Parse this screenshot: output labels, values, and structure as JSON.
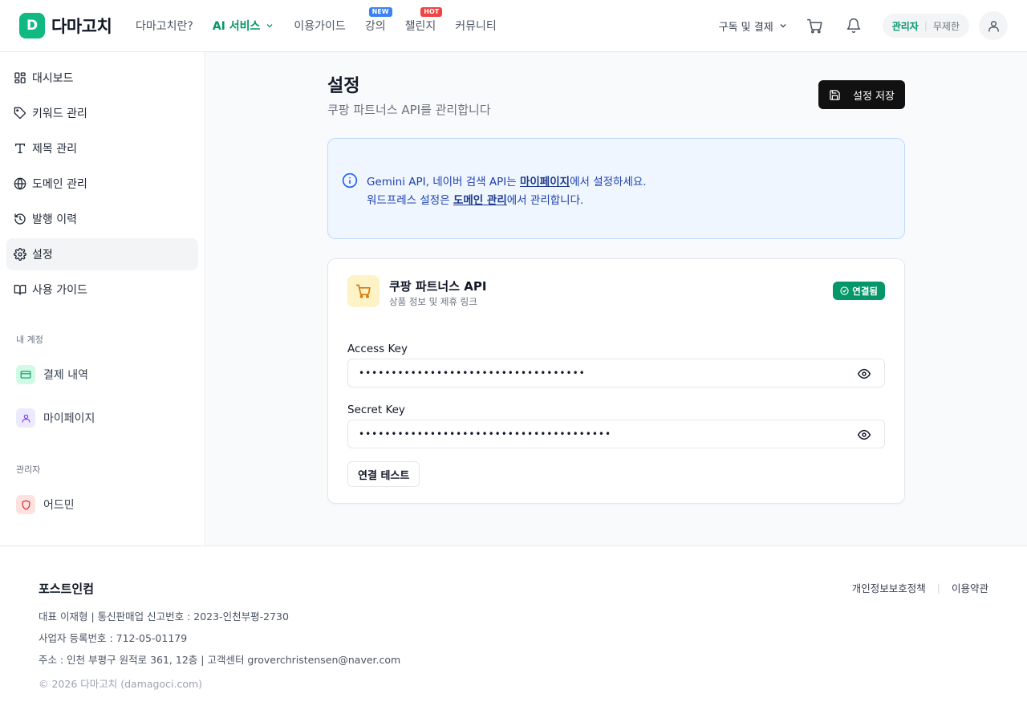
{
  "header": {
    "logo_letter": "D",
    "logo_text": "다마고치",
    "nav": [
      {
        "label": "다마고치란?"
      },
      {
        "label": "AI 서비스"
      },
      {
        "label": "이용가이드"
      },
      {
        "label": "강의",
        "badge": "NEW"
      },
      {
        "label": "챌린지",
        "badge": "HOT"
      },
      {
        "label": "커뮤니티"
      }
    ],
    "subscription_label": "구독 및 결제",
    "role": "관리자",
    "plan": "무제한"
  },
  "sidebar": {
    "items": [
      {
        "label": "대시보드",
        "icon": "dashboard-icon"
      },
      {
        "label": "키워드 관리",
        "icon": "tag-icon"
      },
      {
        "label": "제목 관리",
        "icon": "text-icon"
      },
      {
        "label": "도메인 관리",
        "icon": "globe-icon"
      },
      {
        "label": "발행 이력",
        "icon": "history-icon"
      },
      {
        "label": "설정",
        "icon": "gear-icon"
      },
      {
        "label": "사용 가이드",
        "icon": "book-icon"
      }
    ],
    "account_section": "내 계정",
    "account_items": [
      {
        "label": "결제 내역",
        "icon": "card-icon"
      },
      {
        "label": "마이페이지",
        "icon": "user-icon"
      }
    ],
    "admin_section": "관리자",
    "admin_items": [
      {
        "label": "어드민",
        "icon": "shield-icon"
      }
    ]
  },
  "main": {
    "title": "설정",
    "subtitle": "쿠팡 파트너스 API를 관리합니다",
    "save_label": "설정 저장",
    "info": {
      "line1_prefix": "Gemini API, 네이버 검색 API는 ",
      "line1_link": "마이페이지",
      "line1_suffix": "에서 설정하세요.",
      "line2_prefix": "워드프레스 설정은 ",
      "line2_link": "도메인 관리",
      "line2_suffix": "에서 관리합니다."
    },
    "card": {
      "title": "쿠팡 파트너스 API",
      "description": "상품 정보 및 제휴 링크",
      "status": "연결됨",
      "access_key_label": "Access Key",
      "access_key_value": "•••••••••••••••••••••••••••••••••••",
      "secret_key_label": "Secret Key",
      "secret_key_value": "•••••••••••••••••••••••••••••••••••••••",
      "test_label": "연결 테스트"
    }
  },
  "footer": {
    "company": "포스트인컴",
    "line1": "대표 이재형 | 통신판매업 신고번호 : 2023-인천부평-2730",
    "line2": "사업자 등록번호 : 712-05-01179",
    "line3": "주소 : 인천 부평구 원적로 361, 12층 | 고객센터 groverchristensen@naver.com",
    "copyright": "© 2026 다마고치 (damagoci.com)",
    "privacy": "개인정보보호정책",
    "terms": "이용약관"
  },
  "colors": {
    "brand": "#10b981",
    "brand_dark": "#059669",
    "info_bg": "#eff6ff",
    "info_text": "#1e40af"
  }
}
